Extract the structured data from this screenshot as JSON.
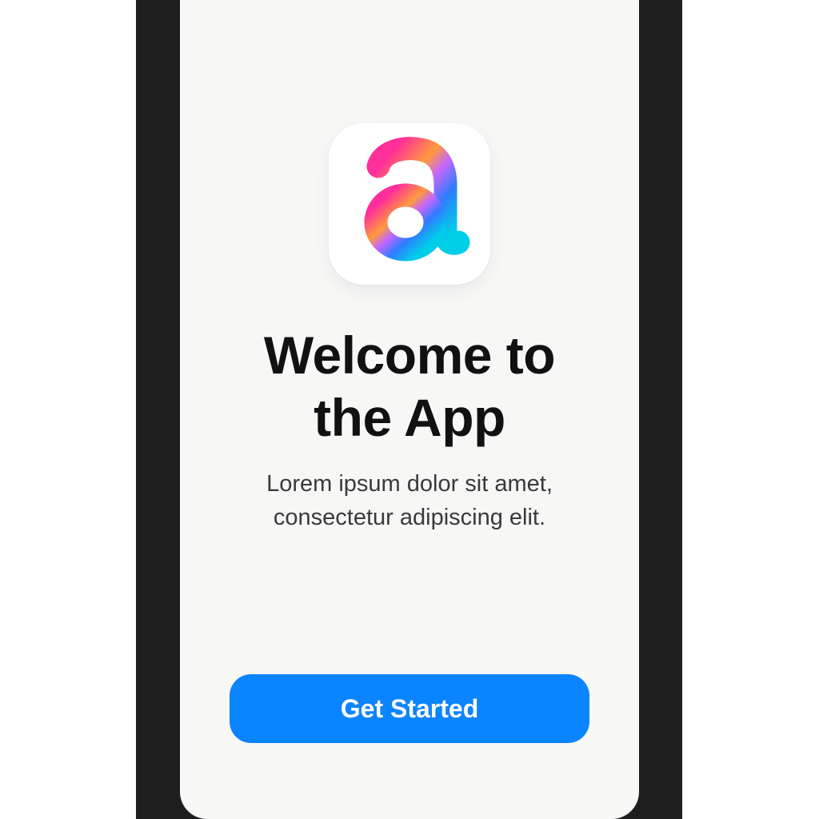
{
  "app_icon": {
    "icon": "gradient-letter-a-logo",
    "glyph": "a",
    "gradient_colors": [
      "#ff3b8d",
      "#ffb020",
      "#b066ff",
      "#2f7cff",
      "#00c8f0"
    ]
  },
  "onboarding": {
    "title_line1": "Welcome to",
    "title_line2": "the App",
    "subtitle_line1": "Lorem ipsum dolor sit amet,",
    "subtitle_line2": "consectetur adipiscing elit.",
    "cta_label": "Get Started"
  },
  "colors": {
    "frame": "#1e1e1e",
    "screen_background": "#f7f7f6",
    "primary_button": "#0a84ff",
    "title_text": "#111111",
    "subtitle_text": "#3a3a3a"
  }
}
